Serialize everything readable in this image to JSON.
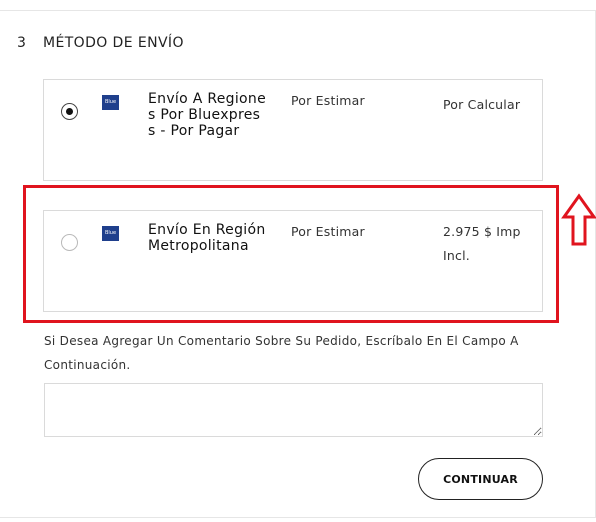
{
  "section": {
    "number": "3",
    "title": "MÉTODO DE ENVÍO"
  },
  "shipping_options": [
    {
      "selected": true,
      "logo_text": "Blue",
      "name": "Envío A Regiones Por Bluexpress - Por Pagar",
      "estimate": "Por Estimar",
      "price": "Por Calcular"
    },
    {
      "selected": false,
      "logo_text": "Blue",
      "name": "Envío En Región Metropolitana",
      "estimate": "Por Estimar",
      "price": "2.975 $ Imp Incl."
    }
  ],
  "comment": {
    "prompt": "Si Desea Agregar Un Comentario Sobre Su Pedido, Escríbalo En El Campo A Continuación.",
    "value": ""
  },
  "actions": {
    "continue_label": "CONTINUAR"
  },
  "colors": {
    "highlight": "#e0141e",
    "logo_blue": "#1f3f8c"
  }
}
